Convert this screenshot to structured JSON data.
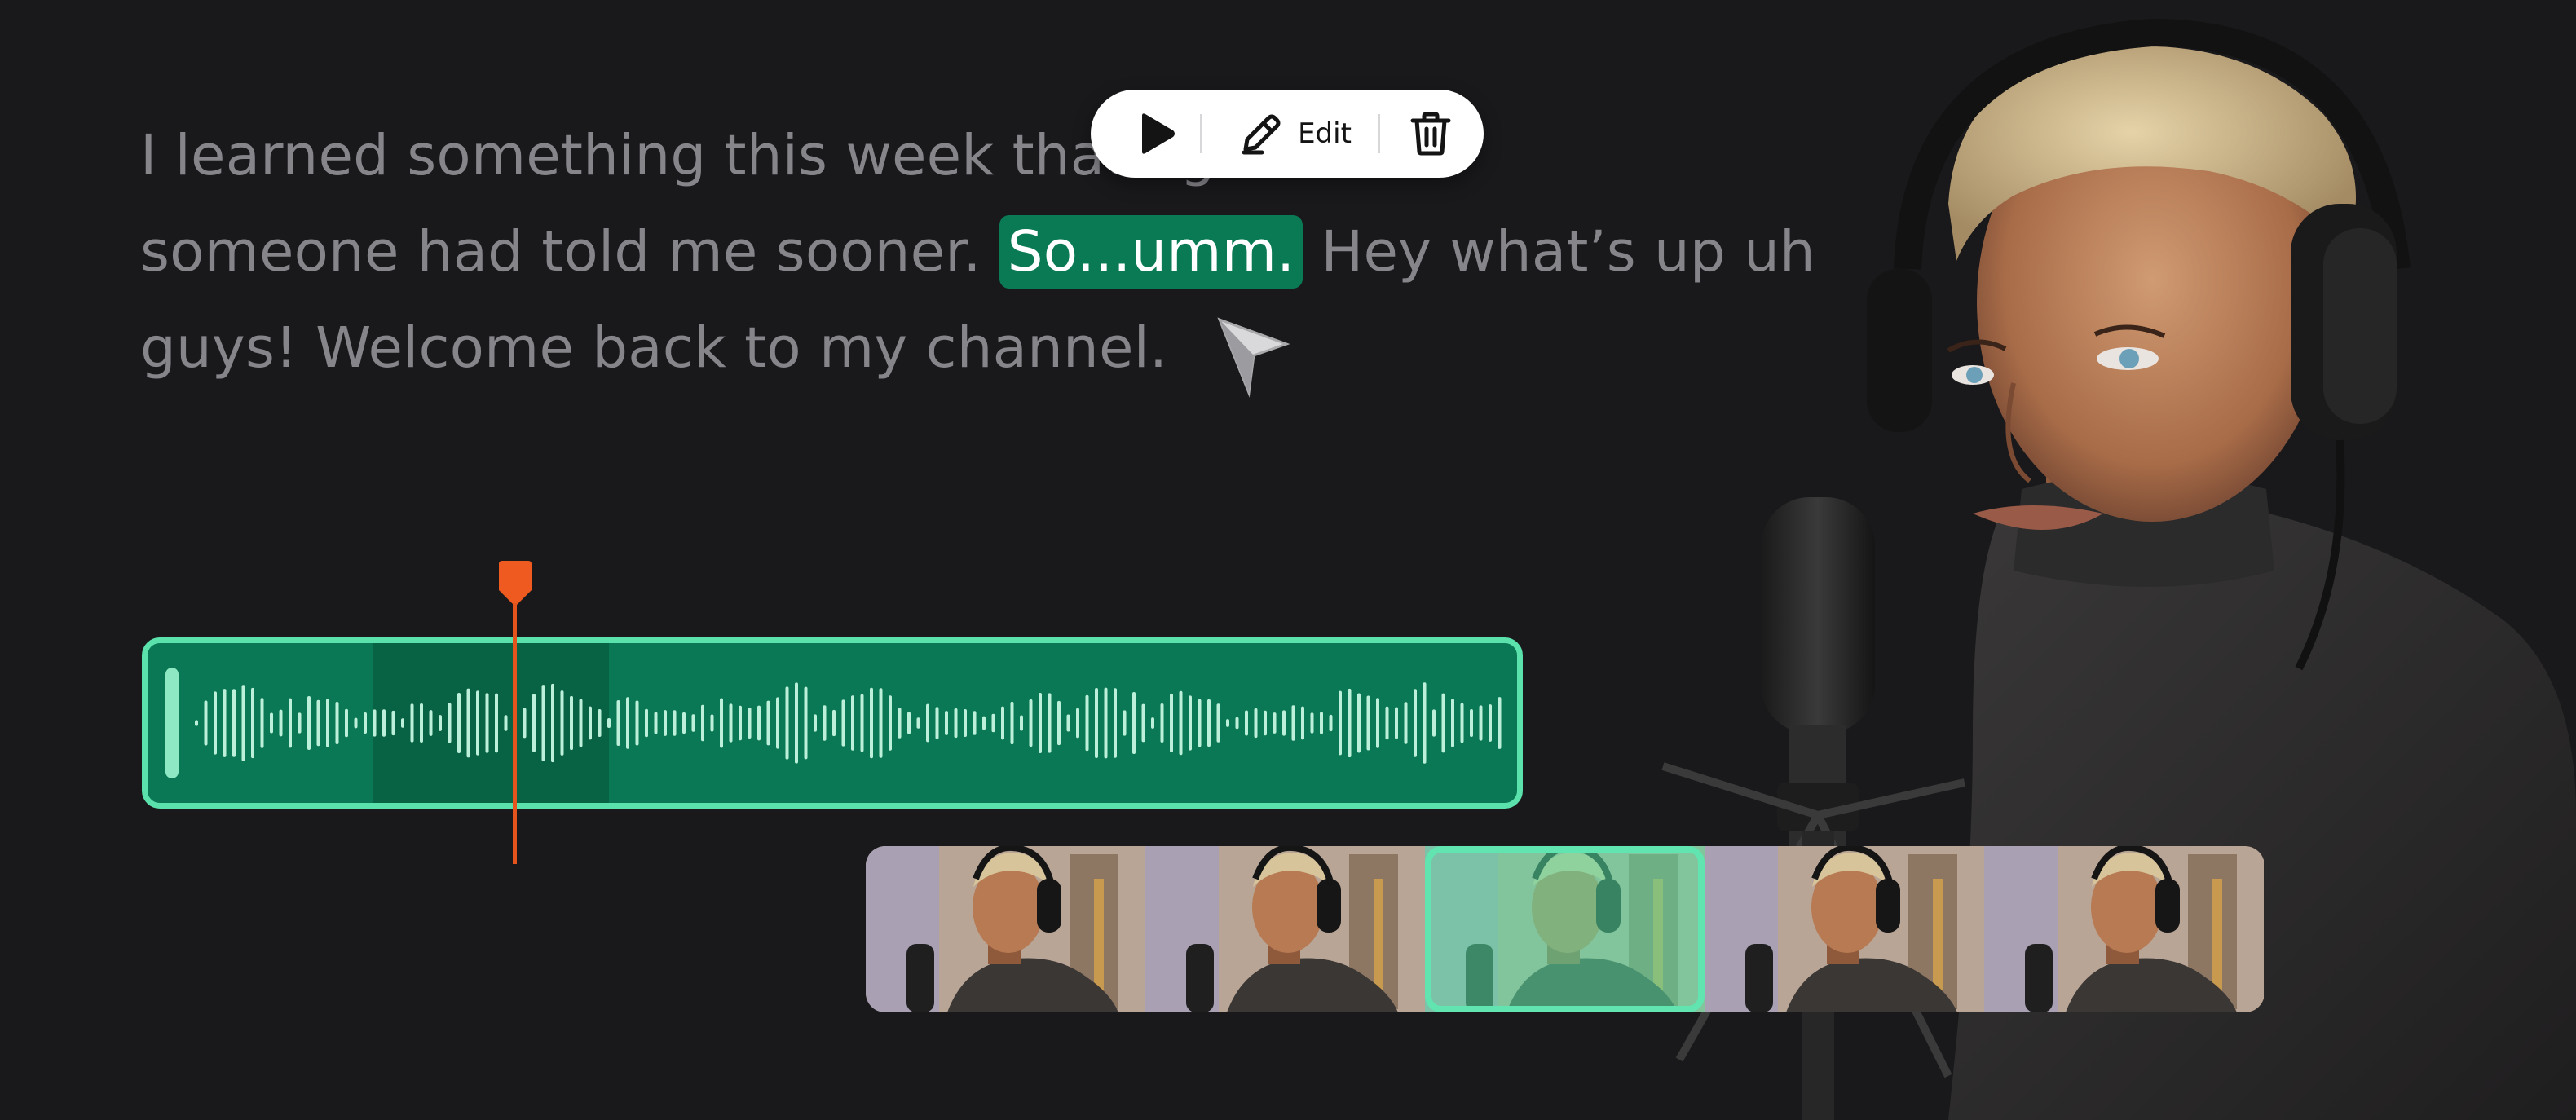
{
  "transcript": {
    "line1": "I learned something this week that I g",
    "line2_before": "someone had told me sooner. ",
    "line2_highlight": "So...umm.",
    "line2_after": " Hey what’s up uh",
    "line3": "guys! Welcome back to my channel."
  },
  "toolbar": {
    "play_icon": "play-icon",
    "edit_icon": "pencil-icon",
    "edit_label": "Edit",
    "delete_icon": "trash-icon"
  },
  "colors": {
    "background": "#19181b",
    "transcript_text": "#86858a",
    "highlight": "#0a7a55",
    "waveform_fill": "#0a7854",
    "waveform_border": "#5be2ac",
    "playhead": "#e4541c"
  },
  "timeline": {
    "frame_count": 5,
    "selected_frame_index": 2
  }
}
